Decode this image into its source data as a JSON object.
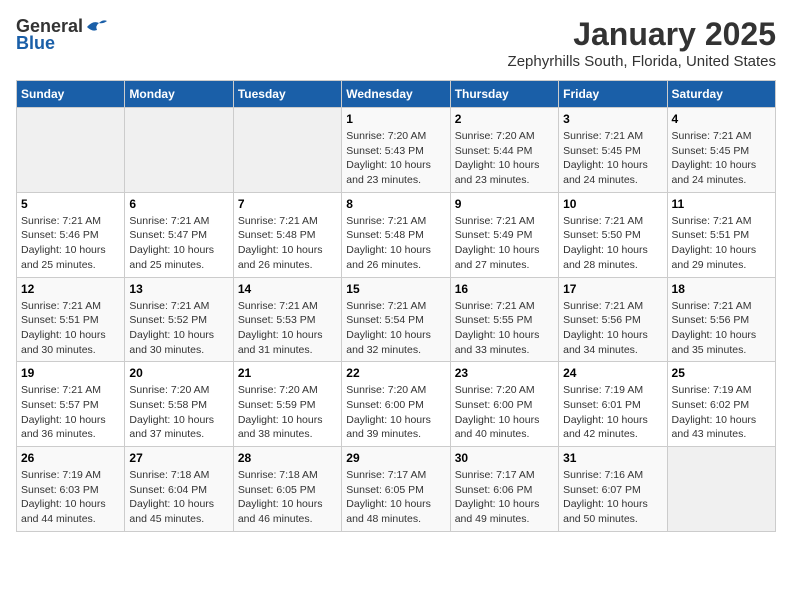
{
  "header": {
    "logo_general": "General",
    "logo_blue": "Blue",
    "title": "January 2025",
    "subtitle": "Zephyrhills South, Florida, United States"
  },
  "days_of_week": [
    "Sunday",
    "Monday",
    "Tuesday",
    "Wednesday",
    "Thursday",
    "Friday",
    "Saturday"
  ],
  "weeks": [
    [
      {
        "day": "",
        "info": ""
      },
      {
        "day": "",
        "info": ""
      },
      {
        "day": "",
        "info": ""
      },
      {
        "day": "1",
        "info": "Sunrise: 7:20 AM\nSunset: 5:43 PM\nDaylight: 10 hours\nand 23 minutes."
      },
      {
        "day": "2",
        "info": "Sunrise: 7:20 AM\nSunset: 5:44 PM\nDaylight: 10 hours\nand 23 minutes."
      },
      {
        "day": "3",
        "info": "Sunrise: 7:21 AM\nSunset: 5:45 PM\nDaylight: 10 hours\nand 24 minutes."
      },
      {
        "day": "4",
        "info": "Sunrise: 7:21 AM\nSunset: 5:45 PM\nDaylight: 10 hours\nand 24 minutes."
      }
    ],
    [
      {
        "day": "5",
        "info": "Sunrise: 7:21 AM\nSunset: 5:46 PM\nDaylight: 10 hours\nand 25 minutes."
      },
      {
        "day": "6",
        "info": "Sunrise: 7:21 AM\nSunset: 5:47 PM\nDaylight: 10 hours\nand 25 minutes."
      },
      {
        "day": "7",
        "info": "Sunrise: 7:21 AM\nSunset: 5:48 PM\nDaylight: 10 hours\nand 26 minutes."
      },
      {
        "day": "8",
        "info": "Sunrise: 7:21 AM\nSunset: 5:48 PM\nDaylight: 10 hours\nand 26 minutes."
      },
      {
        "day": "9",
        "info": "Sunrise: 7:21 AM\nSunset: 5:49 PM\nDaylight: 10 hours\nand 27 minutes."
      },
      {
        "day": "10",
        "info": "Sunrise: 7:21 AM\nSunset: 5:50 PM\nDaylight: 10 hours\nand 28 minutes."
      },
      {
        "day": "11",
        "info": "Sunrise: 7:21 AM\nSunset: 5:51 PM\nDaylight: 10 hours\nand 29 minutes."
      }
    ],
    [
      {
        "day": "12",
        "info": "Sunrise: 7:21 AM\nSunset: 5:51 PM\nDaylight: 10 hours\nand 30 minutes."
      },
      {
        "day": "13",
        "info": "Sunrise: 7:21 AM\nSunset: 5:52 PM\nDaylight: 10 hours\nand 30 minutes."
      },
      {
        "day": "14",
        "info": "Sunrise: 7:21 AM\nSunset: 5:53 PM\nDaylight: 10 hours\nand 31 minutes."
      },
      {
        "day": "15",
        "info": "Sunrise: 7:21 AM\nSunset: 5:54 PM\nDaylight: 10 hours\nand 32 minutes."
      },
      {
        "day": "16",
        "info": "Sunrise: 7:21 AM\nSunset: 5:55 PM\nDaylight: 10 hours\nand 33 minutes."
      },
      {
        "day": "17",
        "info": "Sunrise: 7:21 AM\nSunset: 5:56 PM\nDaylight: 10 hours\nand 34 minutes."
      },
      {
        "day": "18",
        "info": "Sunrise: 7:21 AM\nSunset: 5:56 PM\nDaylight: 10 hours\nand 35 minutes."
      }
    ],
    [
      {
        "day": "19",
        "info": "Sunrise: 7:21 AM\nSunset: 5:57 PM\nDaylight: 10 hours\nand 36 minutes."
      },
      {
        "day": "20",
        "info": "Sunrise: 7:20 AM\nSunset: 5:58 PM\nDaylight: 10 hours\nand 37 minutes."
      },
      {
        "day": "21",
        "info": "Sunrise: 7:20 AM\nSunset: 5:59 PM\nDaylight: 10 hours\nand 38 minutes."
      },
      {
        "day": "22",
        "info": "Sunrise: 7:20 AM\nSunset: 6:00 PM\nDaylight: 10 hours\nand 39 minutes."
      },
      {
        "day": "23",
        "info": "Sunrise: 7:20 AM\nSunset: 6:00 PM\nDaylight: 10 hours\nand 40 minutes."
      },
      {
        "day": "24",
        "info": "Sunrise: 7:19 AM\nSunset: 6:01 PM\nDaylight: 10 hours\nand 42 minutes."
      },
      {
        "day": "25",
        "info": "Sunrise: 7:19 AM\nSunset: 6:02 PM\nDaylight: 10 hours\nand 43 minutes."
      }
    ],
    [
      {
        "day": "26",
        "info": "Sunrise: 7:19 AM\nSunset: 6:03 PM\nDaylight: 10 hours\nand 44 minutes."
      },
      {
        "day": "27",
        "info": "Sunrise: 7:18 AM\nSunset: 6:04 PM\nDaylight: 10 hours\nand 45 minutes."
      },
      {
        "day": "28",
        "info": "Sunrise: 7:18 AM\nSunset: 6:05 PM\nDaylight: 10 hours\nand 46 minutes."
      },
      {
        "day": "29",
        "info": "Sunrise: 7:17 AM\nSunset: 6:05 PM\nDaylight: 10 hours\nand 48 minutes."
      },
      {
        "day": "30",
        "info": "Sunrise: 7:17 AM\nSunset: 6:06 PM\nDaylight: 10 hours\nand 49 minutes."
      },
      {
        "day": "31",
        "info": "Sunrise: 7:16 AM\nSunset: 6:07 PM\nDaylight: 10 hours\nand 50 minutes."
      },
      {
        "day": "",
        "info": ""
      }
    ]
  ]
}
